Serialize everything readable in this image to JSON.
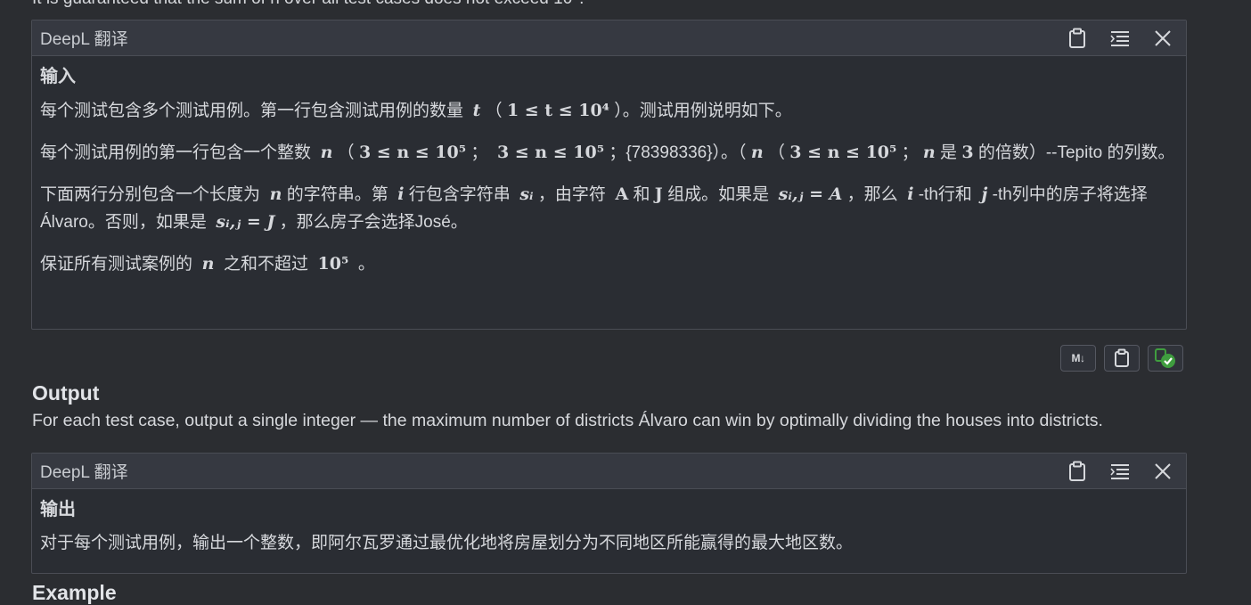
{
  "top_cut_text": "It is guaranteed that the sum of n over all test cases does not exceed 10⁵.",
  "panel1": {
    "title": "DeepL 翻译",
    "heading": "输入",
    "p1_a": "每个测试包含多个测试用例。第一行包含测试用例的数量",
    "p1_var": "t",
    "p1_paren_open": "（",
    "p1_math": "1 ≤ t ≤ 10⁴",
    "p1_b": "）。测试用例说明如下。",
    "p2_a": "每个测试用例的第一行包含一个整数",
    "p2_var": "n",
    "p2_math1": "3 ≤ n ≤ 10⁵",
    "p2_sep": "；",
    "p2_math2": "3 ≤ n ≤ 10⁵",
    "p2_b": "；{78398336}）。（",
    "p2_var2": "n",
    "p2_math3": "3 ≤ n ≤ 10⁵",
    "p2_c": "是",
    "p2_three": "3",
    "p2_d": "的倍数）--Tepito 的列数。",
    "p3_a": "下面两行分别包含一个长度为",
    "p3_var_n": "n",
    "p3_b": "的字符串。第",
    "p3_var_i": "i",
    "p3_c": "行包含字符串",
    "p3_var_si": "sᵢ",
    "p3_d": "，由字符",
    "p3_A": "A",
    "p3_e": "和",
    "p3_J": "J",
    "p3_f": "组成。如果是",
    "p3_sij_A": "sᵢ,ⱼ = A",
    "p3_g": "，那么",
    "p3_i2": "i",
    "p3_h": "-th行和",
    "p3_j": "j",
    "p3_k": "-th列中的房子将选择Álvaro。否则，如果是",
    "p3_sij_J": "sᵢ,ⱼ = J",
    "p3_l": "，那么房子会选择José。",
    "p4_a": "保证所有测试案例的",
    "p4_var": "n",
    "p4_b": "之和不超过",
    "p4_math": "10⁵",
    "p4_c": "。"
  },
  "actions": {
    "md_label": "M↓"
  },
  "output_section": {
    "title": "Output",
    "text": "For each test case, output a single integer — the maximum number of districts Álvaro can win by optimally dividing the houses into districts."
  },
  "panel2": {
    "title": "DeepL 翻译",
    "heading": "输出",
    "text": "对于每个测试用例，输出一个整数，即阿尔瓦罗通过最优化地将房屋划分为不同地区所能赢得的最大地区数。"
  },
  "next_section_cut": "Example"
}
